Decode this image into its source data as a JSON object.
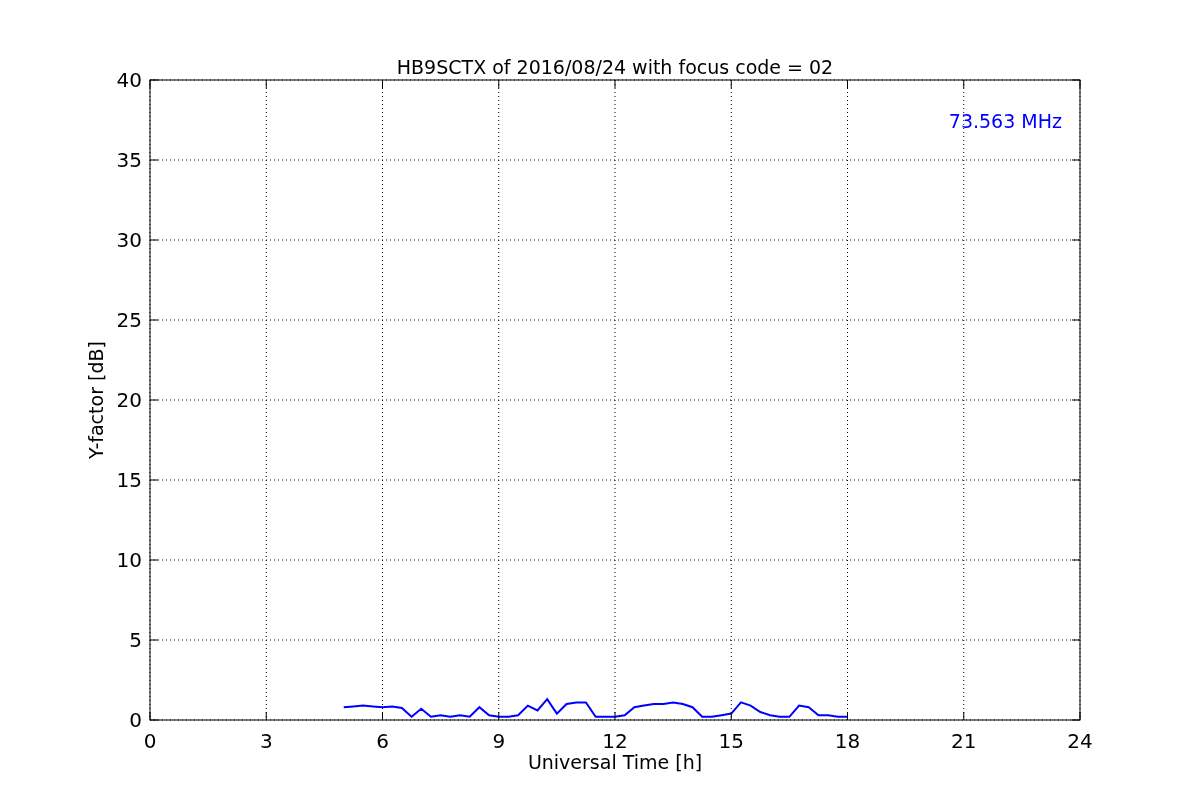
{
  "figure": {
    "chart_data": {
      "type": "line",
      "title": "HB9SCTX of 2016/08/24 with focus code = 02",
      "xlabel": "Universal Time [h]",
      "ylabel": "Y-factor [dB]",
      "x": [
        5,
        5.25,
        5.5,
        5.75,
        6,
        6.25,
        6.5,
        6.75,
        7,
        7.25,
        7.5,
        7.75,
        8,
        8.25,
        8.5,
        8.75,
        9,
        9.25,
        9.5,
        9.75,
        10,
        10.25,
        10.5,
        10.75,
        11,
        11.25,
        11.5,
        11.75,
        12,
        12.25,
        12.5,
        12.75,
        13,
        13.25,
        13.5,
        13.75,
        14,
        14.25,
        14.5,
        14.75,
        15,
        15.25,
        15.5,
        15.75,
        16,
        16.25,
        16.5,
        16.75,
        17,
        17.25,
        17.5,
        17.75,
        18
      ],
      "series": [
        {
          "name": "73.563 MHz",
          "color": "#0000ff",
          "values": [
            0.8,
            0.85,
            0.9,
            0.85,
            0.8,
            0.85,
            0.75,
            0.2,
            0.7,
            0.2,
            0.3,
            0.2,
            0.3,
            0.2,
            0.8,
            0.3,
            0.2,
            0.2,
            0.3,
            0.9,
            0.6,
            1.3,
            0.4,
            1.0,
            1.1,
            1.1,
            0.2,
            0.2,
            0.2,
            0.3,
            0.8,
            0.9,
            1.0,
            1.0,
            1.1,
            1.0,
            0.8,
            0.2,
            0.2,
            0.3,
            0.4,
            1.1,
            0.9,
            0.5,
            0.3,
            0.2,
            0.2,
            0.9,
            0.8,
            0.3,
            0.3,
            0.2,
            0.2
          ]
        }
      ],
      "xlim": [
        0,
        24
      ],
      "ylim": [
        0,
        40
      ],
      "xticks": [
        0,
        3,
        6,
        9,
        12,
        15,
        18,
        21,
        24
      ],
      "yticks": [
        0,
        5,
        10,
        15,
        20,
        25,
        30,
        35,
        40
      ],
      "grid": true
    }
  }
}
